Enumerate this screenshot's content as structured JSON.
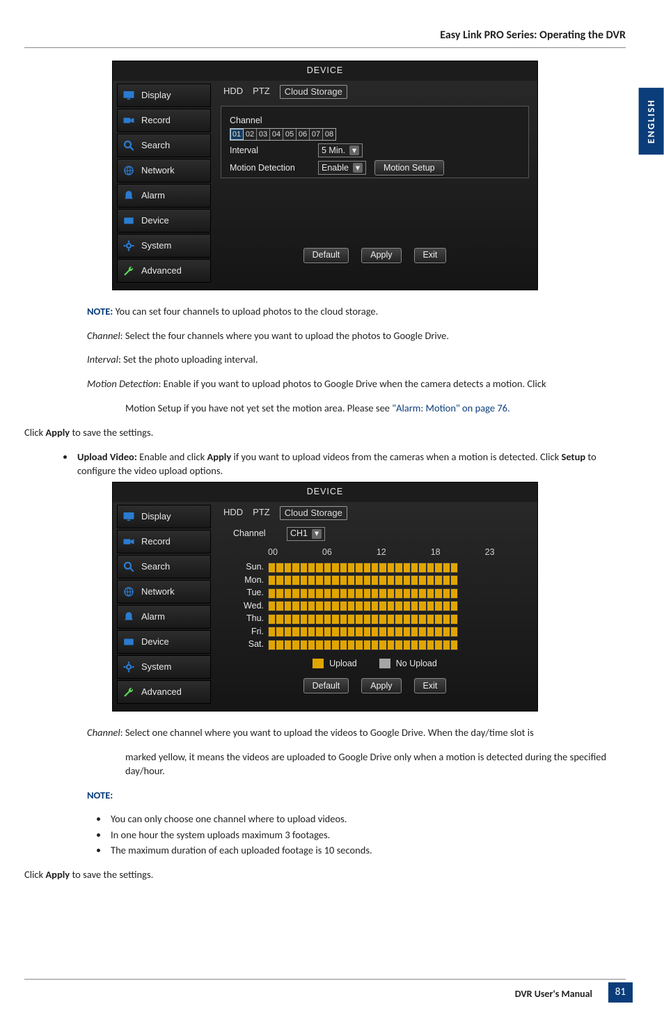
{
  "header": "Easy Link PRO Series: Operating the DVR",
  "side_tab": "ENGLISH",
  "dvr": {
    "title": "DEVICE",
    "sidebar": [
      "Display",
      "Record",
      "Search",
      "Network",
      "Alarm",
      "Device",
      "System",
      "Advanced"
    ],
    "tabs": [
      "HDD",
      "PTZ",
      "Cloud Storage"
    ],
    "selected_tab": "Cloud Storage",
    "panel1": {
      "channel_label": "Channel",
      "channels": [
        "01",
        "02",
        "03",
        "04",
        "05",
        "06",
        "07",
        "08"
      ],
      "selected_channel_index": 0,
      "interval_label": "Interval",
      "interval_value": "5 Min.",
      "motion_label": "Motion Detection",
      "motion_value": "Enable",
      "motion_setup_btn": "Motion Setup"
    },
    "panel2": {
      "channel_label": "Channel",
      "channel_value": "CH1",
      "hours": [
        "00",
        "06",
        "12",
        "18",
        "23"
      ],
      "days": [
        "Sun.",
        "Mon.",
        "Tue.",
        "Wed.",
        "Thu.",
        "Fri.",
        "Sat."
      ],
      "legend_upload": "Upload",
      "legend_noupload": "No Upload"
    },
    "actions": {
      "default": "Default",
      "apply": "Apply",
      "exit": "Exit"
    }
  },
  "text": {
    "note_label": "NOTE:",
    "note1_rest": " You can set four channels to upload photos to the cloud storage.",
    "channel_line": {
      "lead": "Channel",
      "rest": ": Select the four channels where you want to upload the photos to Google Drive."
    },
    "interval_line": {
      "lead": "Interval",
      "rest": ": Set the photo uploading interval."
    },
    "motion_line": {
      "lead": "Motion Detection",
      "rest": ": Enable if you want to upload photos to Google Drive when the camera detects a motion. Click Motion Setup if you have not yet set the motion area. Please see ",
      "link": "\"Alarm: Motion\" on page 76.",
      "cont_prefix": "Motion Setup if you have not yet set the motion area. Please see "
    },
    "click_apply": "Click Apply to save the settings.",
    "upload_video": {
      "bullet_lead": "Upload Video:",
      "rest": " Enable and click Apply if you want to upload videos from the cameras when a motion is detected. Click Setup to configure the video upload options."
    },
    "channel_line2": {
      "lead": "Channel",
      "rest": ": Select one channel where you want to upload the videos to Google Drive. When the day/time slot is marked yellow, it means the videos are uploaded to Google Drive only when a motion is detected during the specified day/hour."
    },
    "notes2": [
      "You can only choose one channel where to upload videos.",
      "In one hour the system uploads maximum 3 footages.",
      "The maximum duration of each uploaded footage is 10 seconds."
    ]
  },
  "footer": {
    "label": "DVR User's Manual",
    "page": "81"
  }
}
